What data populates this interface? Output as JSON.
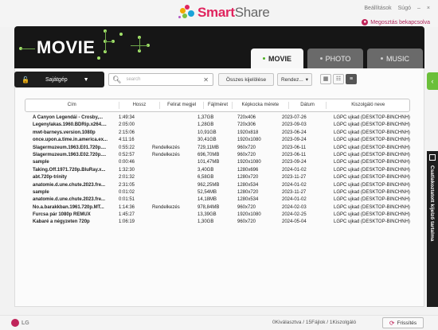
{
  "app": {
    "logo_text_1": "Smart",
    "logo_text_2": "Share",
    "top_links": [
      "Beállítások",
      "Súgó",
      "–",
      "×"
    ],
    "share_link": "Megosztás bekapcsolva"
  },
  "banner": {
    "title": "MOVIE"
  },
  "tabs": [
    {
      "label": "MOVIE",
      "active": true
    },
    {
      "label": "PHOTO",
      "active": false
    },
    {
      "label": "MUSIC",
      "active": false
    }
  ],
  "toolbar": {
    "device_label": "Sajátgép",
    "search_placeholder": "search",
    "select_all": "Összes kijelölése",
    "sort": "Rendez...",
    "sort_caret": "▾"
  },
  "table": {
    "headers": [
      "Cím",
      "Hossz",
      "Felirat megjel",
      "Fájlméret",
      "Képkocka mérete",
      "Dátum",
      "Kiszolgáló neve"
    ],
    "rows": [
      [
        "A Canyon Legendái - Crosby,...",
        "1:49:34",
        "",
        "1,37GB",
        "720x406",
        "2023-07-26",
        "LGPC ujkad (DESKTOP-BINCHNH)"
      ],
      [
        "Legenylakas.1960.BDRip.x264....",
        "2:05:00",
        "",
        "1,28GB",
        "720x306",
        "2023-09-03",
        "LGPC ujkad (DESKTOP-BINCHNH)"
      ],
      [
        "mwt-barneys.version.1080p",
        "2:15:06",
        "",
        "10,91GB",
        "1920x818",
        "2023-06-24",
        "LGPC ujkad (DESKTOP-BINCHNH)"
      ],
      [
        "once.upon.a.time.in.america.ex...",
        "4:11:16",
        "",
        "30,41GB",
        "1920x1080",
        "2023-09-24",
        "LGPC ujkad (DESKTOP-BINCHNH)"
      ],
      [
        "Slagermuzeum.1963.E01.720p....",
        "0:55:22",
        "Rendelkezés",
        "729,11MB",
        "960x720",
        "2023-06-11",
        "LGPC ujkad (DESKTOP-BINCHNH)"
      ],
      [
        "Slagermuzeum.1963.E02.720p....",
        "0:52:57",
        "Rendelkezés",
        "696,70MB",
        "960x720",
        "2023-06-11",
        "LGPC ujkad (DESKTOP-BINCHNH)"
      ],
      [
        "sample",
        "0:00:46",
        "",
        "101,47MB",
        "1920x1080",
        "2023-09-24",
        "LGPC ujkad (DESKTOP-BINCHNH)"
      ],
      [
        "Taking.Off.1971.720p.BluRay.x...",
        "1:32:30",
        "",
        "3,40GB",
        "1280x696",
        "2024-01-02",
        "LGPC ujkad (DESKTOP-BINCHNH)"
      ],
      [
        "abt.720p-trinity",
        "2:01:32",
        "",
        "6,58GB",
        "1280x720",
        "2023-11-27",
        "LGPC ujkad (DESKTOP-BINCHNH)"
      ],
      [
        "anatomie.d.une.chute.2023.fre...",
        "2:31:05",
        "",
        "962,25MB",
        "1280x534",
        "2024-01-02",
        "LGPC ujkad (DESKTOP-BINCHNH)"
      ],
      [
        "sample",
        "0:01:02",
        "",
        "52,54MB",
        "1280x720",
        "2023-11-27",
        "LGPC ujkad (DESKTOP-BINCHNH)"
      ],
      [
        "anatomie.d.une.chute.2023.fre...",
        "0:01:51",
        "",
        "14,18MB",
        "1280x534",
        "2024-01-02",
        "LGPC ujkad (DESKTOP-BINCHNH)"
      ],
      [
        "No.a.barakkban.1961.720p.MT...",
        "1:14:36",
        "Rendelkezés",
        "978,84MB",
        "960x720",
        "2024-02-03",
        "LGPC ujkad (DESKTOP-BINCHNH)"
      ],
      [
        "Furcsa pár 1080p REMUX",
        "1:45:27",
        "",
        "13,39GB",
        "1920x1080",
        "2024-02-25",
        "LGPC ujkad (DESKTOP-BINCHNH)"
      ],
      [
        "Kabaré a négyzeten 720p",
        "1:06:19",
        "",
        "1,30GB",
        "960x720",
        "2024-05-04",
        "LGPC ujkad (DESKTOP-BINCHNH)"
      ]
    ]
  },
  "sidepanel": {
    "label": "Csatlakoztatott kijelző tartalma"
  },
  "footer": {
    "brand": "LG",
    "status": "0Kiválasztva / 15Fájlok / 1Kiszolgáló",
    "refresh": "Frissítés"
  },
  "colors": {
    "accent": "#c0245a",
    "green": "#6bbf3a",
    "dark": "#161616"
  }
}
